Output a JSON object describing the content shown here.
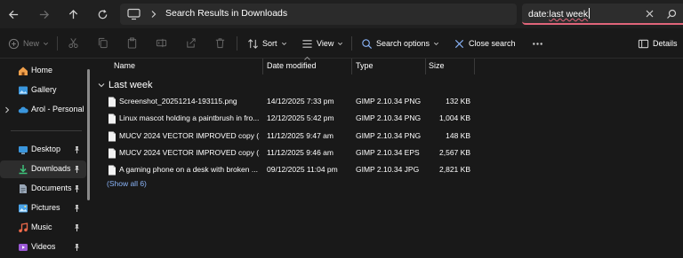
{
  "address_bar": {
    "location": "Search Results in Downloads"
  },
  "search": {
    "value_prefix": "date:",
    "value_underlined": "last week"
  },
  "toolbar": {
    "new_label": "New",
    "sort_label": "Sort",
    "view_label": "View",
    "search_options_label": "Search options",
    "close_search_label": "Close search",
    "details_label": "Details"
  },
  "sidebar": {
    "items": [
      {
        "label": "Home"
      },
      {
        "label": "Gallery"
      },
      {
        "label": "Arol - Personal"
      },
      {
        "label": "Desktop"
      },
      {
        "label": "Downloads"
      },
      {
        "label": "Documents"
      },
      {
        "label": "Pictures"
      },
      {
        "label": "Music"
      },
      {
        "label": "Videos"
      }
    ]
  },
  "columns": {
    "name": "Name",
    "date": "Date modified",
    "type": "Type",
    "size": "Size"
  },
  "group": {
    "label": "Last week"
  },
  "files": [
    {
      "name": "Screenshot_20251214-193115.png",
      "date": "14/12/2025 7:33 pm",
      "type": "GIMP 2.10.34 PNG",
      "size": "132 KB"
    },
    {
      "name": "Linux mascot holding a paintbrush in fro...",
      "date": "12/12/2025 5:42 pm",
      "type": "GIMP 2.10.34 PNG",
      "size": "1,004 KB"
    },
    {
      "name": "MUCV 2024 VECTOR IMPROVED copy (1)....",
      "date": "11/12/2025 9:47 am",
      "type": "GIMP 2.10.34 PNG",
      "size": "148 KB"
    },
    {
      "name": "MUCV 2024 VECTOR IMPROVED copy (1)....",
      "date": "11/12/2025 9:46 am",
      "type": "GIMP 2.10.34 EPS",
      "size": "2,567 KB"
    },
    {
      "name": "A gaming phone on a desk with broken ...",
      "date": "09/12/2025 11:04 pm",
      "type": "GIMP 2.10.34 JPG",
      "size": "2,821 KB"
    }
  ],
  "show_all_label": "(Show all 6)",
  "colors": {
    "accent": "#8ab4f8",
    "search_underline": "#e0657a",
    "folder_yellow": "#f5c64a",
    "onedrive_blue": "#3a96dd"
  }
}
